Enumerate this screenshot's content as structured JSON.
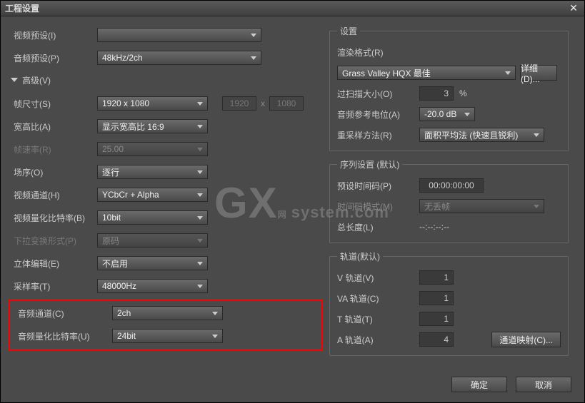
{
  "title": "工程设置",
  "left": {
    "video_preset_label": "视频预设(I)",
    "video_preset_value": "",
    "audio_preset_label": "音频预设(P)",
    "audio_preset_value": "48kHz/2ch",
    "advanced_label": "高级(V)",
    "frame_size_label": "帧尺寸(S)",
    "frame_size_value": "1920 x 1080",
    "frame_w": "1920",
    "frame_x": "x",
    "frame_h": "1080",
    "aspect_label": "宽高比(A)",
    "aspect_value": "显示宽高比 16:9",
    "frame_rate_label": "帧速率(R)",
    "frame_rate_value": "25.00",
    "field_order_label": "场序(O)",
    "field_order_value": "逐行",
    "video_channel_label": "视频通道(H)",
    "video_channel_value": "YCbCr + Alpha",
    "video_bit_label": "视频量化比特率(B)",
    "video_bit_value": "10bit",
    "pulldown_label": "下拉变换形式(P)",
    "pulldown_value": "原码",
    "stereo_label": "立体编辑(E)",
    "stereo_value": "不启用",
    "sample_rate_label": "采样率(T)",
    "sample_rate_value": "48000Hz",
    "audio_channel_label": "音频通道(C)",
    "audio_channel_value": "2ch",
    "audio_bit_label": "音频量化比特率(U)",
    "audio_bit_value": "24bit"
  },
  "settings": {
    "group_label": "设置",
    "render_format_label": "渲染格式(R)",
    "render_format_value": "Grass Valley HQX 最佳",
    "detail_btn": "详细(D)...",
    "overscan_label": "过扫描大小(O)",
    "overscan_value": "3",
    "overscan_unit": "%",
    "audio_ref_label": "音频参考电位(A)",
    "audio_ref_value": "-20.0 dB",
    "resample_label": "重采样方法(R)",
    "resample_value": "面积平均法 (快速且锐利)"
  },
  "sequence": {
    "group_label": "序列设置 (默认)",
    "preset_tc_label": "预设时间码(P)",
    "preset_tc_value": "00:00:00:00",
    "tc_mode_label": "时间码模式(M)",
    "tc_mode_value": "无丢帧",
    "total_len_label": "总长度(L)",
    "total_len_value": "--:--:--:--"
  },
  "tracks": {
    "group_label": "轨道(默认)",
    "v_label": "V 轨道(V)",
    "v_value": "1",
    "va_label": "VA 轨道(C)",
    "va_value": "1",
    "t_label": "T 轨道(T)",
    "t_value": "1",
    "a_label": "A 轨道(A)",
    "a_value": "4",
    "channel_map_btn": "通道映射(C)..."
  },
  "footer": {
    "ok": "确定",
    "cancel": "取消"
  },
  "watermark": {
    "gx": "GX",
    "net": "网",
    "sub": "system.com"
  }
}
